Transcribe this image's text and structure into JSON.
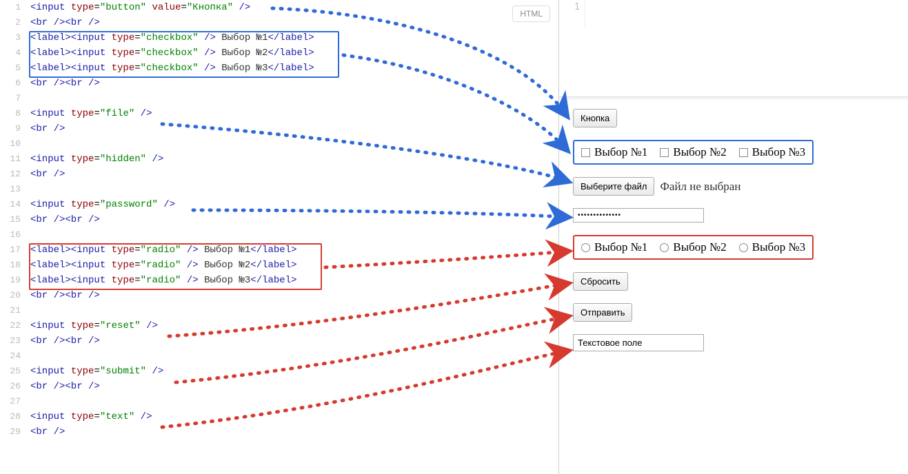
{
  "badge": "HTML",
  "code": {
    "lines": [
      {
        "n": 1,
        "html": "<span class='tag'>&lt;input</span> <span class='attr'>type</span>=<span class='val'>\"button\"</span> <span class='attr'>value</span>=<span class='val'>\"Кнопка\"</span> <span class='tag'>/&gt;</span>"
      },
      {
        "n": 2,
        "html": "<span class='tag'>&lt;br /&gt;&lt;br /&gt;</span>"
      },
      {
        "n": 3,
        "html": "<span class='tag'>&lt;label&gt;&lt;input</span> <span class='attr'>type</span>=<span class='val'>\"checkbox\"</span> <span class='tag'>/&gt;</span><span class='txt'> Выбор №1</span><span class='tag'>&lt;/label&gt;</span>"
      },
      {
        "n": 4,
        "html": "<span class='tag'>&lt;label&gt;&lt;input</span> <span class='attr'>type</span>=<span class='val'>\"checkbox\"</span> <span class='tag'>/&gt;</span><span class='txt'> Выбор №2</span><span class='tag'>&lt;/label&gt;</span>"
      },
      {
        "n": 5,
        "html": "<span class='tag'>&lt;label&gt;&lt;input</span> <span class='attr'>type</span>=<span class='val'>\"checkbox\"</span> <span class='tag'>/&gt;</span><span class='txt'> Выбор №3</span><span class='tag'>&lt;/label&gt;</span>"
      },
      {
        "n": 6,
        "html": "<span class='tag'>&lt;br /&gt;&lt;br /&gt;</span>"
      },
      {
        "n": 7,
        "html": ""
      },
      {
        "n": 8,
        "html": "<span class='tag'>&lt;input</span> <span class='attr'>type</span>=<span class='val'>\"file\"</span> <span class='tag'>/&gt;</span>"
      },
      {
        "n": 9,
        "html": "<span class='tag'>&lt;br /&gt;</span>"
      },
      {
        "n": 10,
        "html": ""
      },
      {
        "n": 11,
        "html": "<span class='tag'>&lt;input</span> <span class='attr'>type</span>=<span class='val'>\"hidden\"</span> <span class='tag'>/&gt;</span>"
      },
      {
        "n": 12,
        "html": "<span class='tag'>&lt;br /&gt;</span>"
      },
      {
        "n": 13,
        "html": ""
      },
      {
        "n": 14,
        "html": "<span class='tag'>&lt;input</span> <span class='attr'>type</span>=<span class='val'>\"password\"</span> <span class='tag'>/&gt;</span>"
      },
      {
        "n": 15,
        "html": "<span class='tag'>&lt;br /&gt;&lt;br /&gt;</span>"
      },
      {
        "n": 16,
        "html": ""
      },
      {
        "n": 17,
        "html": "<span class='tag'>&lt;label&gt;&lt;input</span> <span class='attr'>type</span>=<span class='val'>\"radio\"</span> <span class='tag'>/&gt;</span><span class='txt'> Выбор №1</span><span class='tag'>&lt;/label&gt;</span>"
      },
      {
        "n": 18,
        "html": "<span class='tag'>&lt;label&gt;&lt;input</span> <span class='attr'>type</span>=<span class='val'>\"radio\"</span> <span class='tag'>/&gt;</span><span class='txt'> Выбор №2</span><span class='tag'>&lt;/label&gt;</span>"
      },
      {
        "n": 19,
        "html": "<span class='tag'>&lt;label&gt;&lt;input</span> <span class='attr'>type</span>=<span class='val'>\"radio\"</span> <span class='tag'>/&gt;</span><span class='txt'> Выбор №3</span><span class='tag'>&lt;/label&gt;</span>"
      },
      {
        "n": 20,
        "html": "<span class='tag'>&lt;br /&gt;&lt;br /&gt;</span>"
      },
      {
        "n": 21,
        "html": ""
      },
      {
        "n": 22,
        "html": "<span class='tag'>&lt;input</span> <span class='attr'>type</span>=<span class='val'>\"reset\"</span> <span class='tag'>/&gt;</span>"
      },
      {
        "n": 23,
        "html": "<span class='tag'>&lt;br /&gt;&lt;br /&gt;</span>"
      },
      {
        "n": 24,
        "html": ""
      },
      {
        "n": 25,
        "html": "<span class='tag'>&lt;input</span> <span class='attr'>type</span>=<span class='val'>\"submit\"</span> <span class='tag'>/&gt;</span>"
      },
      {
        "n": 26,
        "html": "<span class='tag'>&lt;br /&gt;&lt;br /&gt;</span>"
      },
      {
        "n": 27,
        "html": ""
      },
      {
        "n": 28,
        "html": "<span class='tag'>&lt;input</span> <span class='attr'>type</span>=<span class='val'>\"text\"</span> <span class='tag'>/&gt;</span>"
      },
      {
        "n": 29,
        "html": "<span class='tag'>&lt;br /&gt;</span>"
      }
    ]
  },
  "preview": {
    "gutter_line": "1",
    "button_label": "Кнопка",
    "checkboxes": [
      "Выбор №1",
      "Выбор №2",
      "Выбор №3"
    ],
    "file_button": "Выберите файл",
    "file_status": "Файл не выбран",
    "password_value": "••••••••••••••",
    "radios": [
      "Выбор №1",
      "Выбор №2",
      "Выбор №3"
    ],
    "reset_label": "Сбросить",
    "submit_label": "Отправить",
    "text_value": "Текстовое поле"
  }
}
